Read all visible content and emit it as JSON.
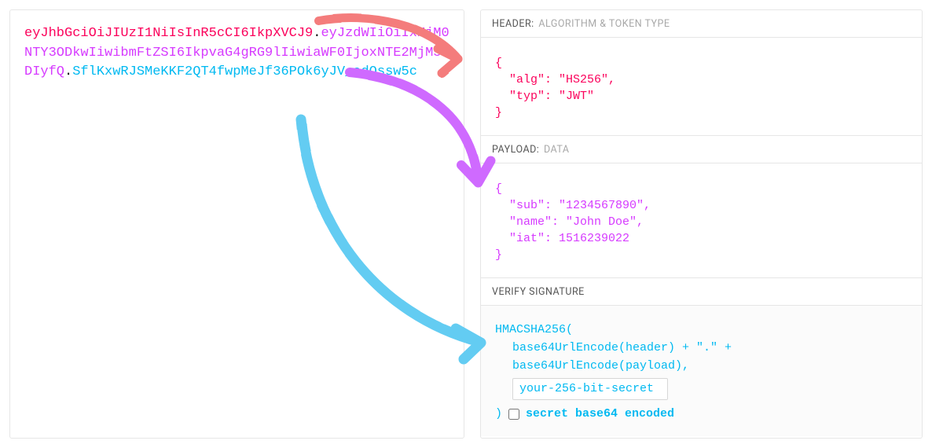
{
  "token": {
    "header_b64": "eyJhbGciOiJIUzI1NiIsInR5cCI6IkpXVCJ9",
    "payload_b64": "eyJzdWIiOiIxMjM0NTY3ODkwIiwibmFtZSI6IkpvaG4gRG9lIiwiaWF0IjoxNTE2MjM5MDIyfQ",
    "signature_b64": "SflKxwRJSMeKKF2QT4fwpMeJf36POk6yJV_adQssw5c",
    "dot": "."
  },
  "sections": {
    "header": {
      "title": "HEADER:",
      "subtitle": "ALGORITHM & TOKEN TYPE",
      "json": "{\n  \"alg\": \"HS256\",\n  \"typ\": \"JWT\"\n}"
    },
    "payload": {
      "title": "PAYLOAD:",
      "subtitle": "DATA",
      "json": "{\n  \"sub\": \"1234567890\",\n  \"name\": \"John Doe\",\n  \"iat\": 1516239022\n}"
    },
    "signature": {
      "title": "VERIFY SIGNATURE",
      "fn_open": "HMACSHA256(",
      "line1": "base64UrlEncode(header) + \".\" +",
      "line2": "base64UrlEncode(payload),",
      "secret_placeholder": "your-256-bit-secret",
      "secret_value": "your-256-bit-secret",
      "fn_close": ")",
      "checkbox_label": "secret base64 encoded"
    }
  }
}
